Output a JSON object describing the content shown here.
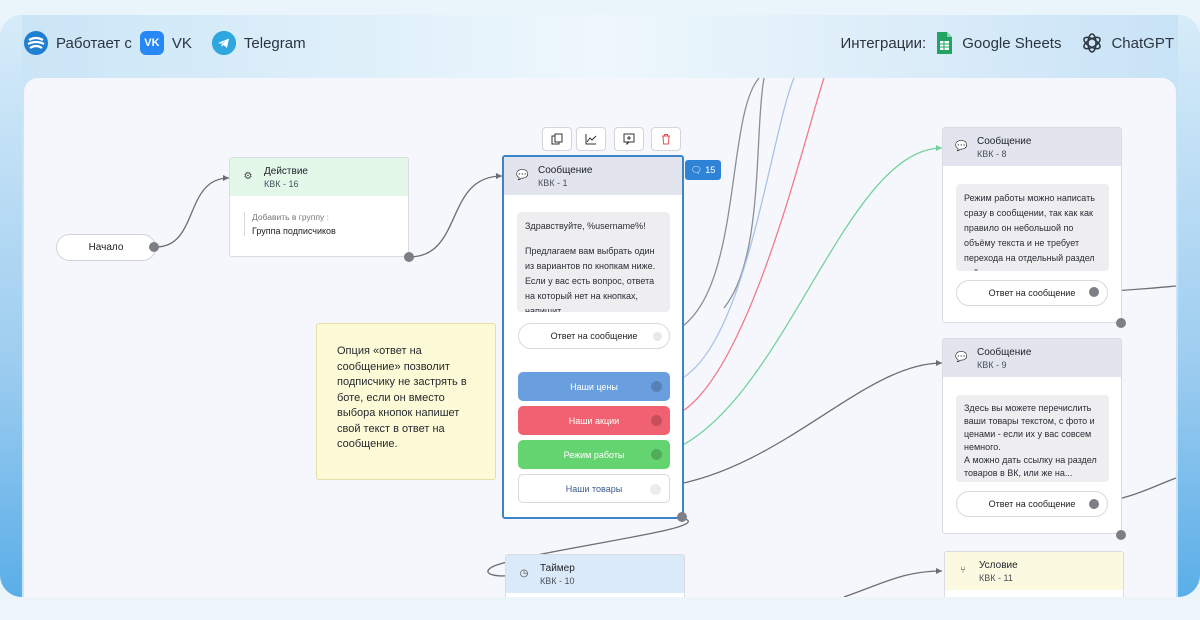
{
  "topbar": {
    "works_with": "Работает с",
    "vk": "VK",
    "vk_logo": "VK",
    "telegram": "Telegram",
    "integrations": "Интеграции:",
    "google_sheets": "Google Sheets",
    "chatgpt": "ChatGPT"
  },
  "icons": {
    "brand": "brand-logo-icon",
    "vk": "vk-icon",
    "telegram": "telegram-icon",
    "sheets": "google-sheets-icon",
    "chatgpt": "chatgpt-icon"
  },
  "colors": {
    "blue_button": "#6a9fdf",
    "red_button": "#f06271",
    "green_button": "#64d470",
    "action_head": "#e3f8e8",
    "message_head": "#e2e5ee",
    "timer_head": "#dbeaf9",
    "condition_head": "#fbfae0",
    "badge": "#2f83d6"
  },
  "start": {
    "label": "Начало"
  },
  "action": {
    "title": "Действие",
    "sub": "КВК - 16",
    "field_label": "Добавить в группу :",
    "field_value": "Группа подписчиков"
  },
  "toolbar": {
    "copy": "copy-icon",
    "stats": "chart-icon",
    "comment": "comment-add-icon",
    "delete": "trash-icon"
  },
  "main_message": {
    "title": "Сообщение",
    "sub": "КВК - 1",
    "badge_count": "15",
    "text_greeting": "Здравствуйте, %username%!",
    "text_body": "Предлагаем вам выбрать один из вариантов по кнопкам ниже. Если у вас есть вопрос, ответа на который нет на кнопках, напишит...",
    "reply_button": "Ответ на сообщение",
    "buttons": [
      "Наши цены",
      "Наши акции",
      "Режим работы",
      "Наши товары"
    ]
  },
  "note": {
    "text": "Опция «ответ на сообщение» позволит подписчику не застрять в боте, если он вместо выбора кнопок напишет свой текст в ответ на сообщение."
  },
  "message8": {
    "title": "Сообщение",
    "sub": "КВК - 8",
    "text": "Режим работы можно написать сразу в сообщении, так как как правило он небольшой по объёму текста и не требует перехода на отдельный раздел сайта.",
    "reply_button": "Ответ на сообщение"
  },
  "message9": {
    "title": "Сообщение",
    "sub": "КВК - 9",
    "text_1": "Здесь вы можете перечислить ваши товары текстом, с фото и ценами - если их у вас совсем немного.",
    "text_2": "А можно дать ссылку на раздел товаров в ВК, или же на...",
    "reply_button": "Ответ на сообщение"
  },
  "timer": {
    "title": "Таймер",
    "sub": "КВК - 10"
  },
  "condition": {
    "title": "Условие",
    "sub": "КВК - 11"
  }
}
